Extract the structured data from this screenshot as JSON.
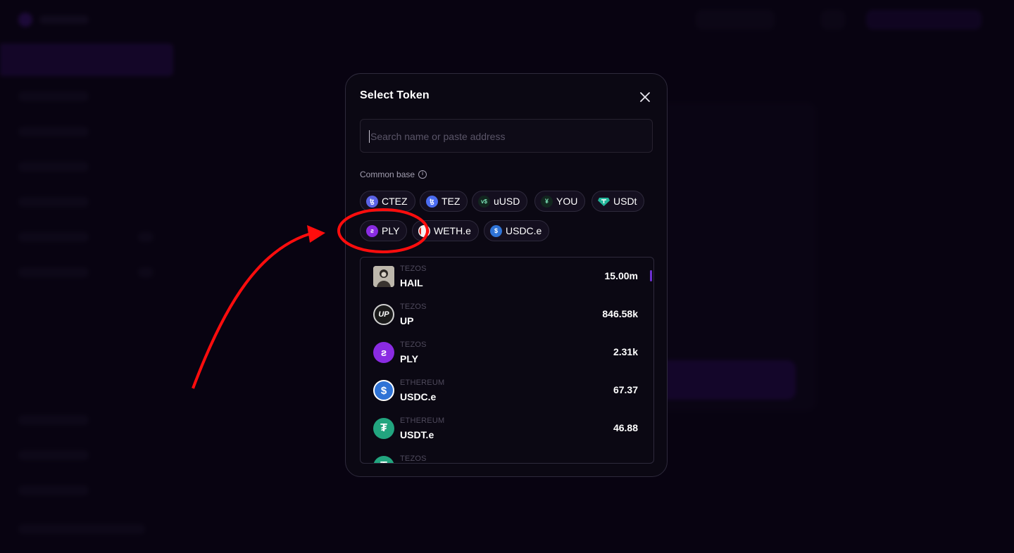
{
  "modal": {
    "title": "Select Token",
    "search_placeholder": "Search name or paste address",
    "common_base_label": "Common base"
  },
  "common_base": [
    {
      "label": "CTEZ",
      "icon": "ctez-icon",
      "color": "#5b63e6"
    },
    {
      "label": "TEZ",
      "icon": "tez-icon",
      "color": "#4b6cf0"
    },
    {
      "label": "uUSD",
      "icon": "uusd-icon",
      "color": "#1f3a2e"
    },
    {
      "label": "YOU",
      "icon": "you-icon",
      "color": "#1c3a30"
    },
    {
      "label": "USDt",
      "icon": "usdt-icon",
      "color": "#22b59a"
    },
    {
      "label": "PLY",
      "icon": "ply-icon",
      "color": "#8a2be2"
    },
    {
      "label": "WETH.e",
      "icon": "weth-icon",
      "color": "#e8e8e8"
    },
    {
      "label": "USDC.e",
      "icon": "usdc-icon",
      "color": "#2f73d6"
    }
  ],
  "tokens": [
    {
      "chain": "TEZOS",
      "symbol": "HAIL",
      "balance": "15.00m",
      "icon": "hail-icon"
    },
    {
      "chain": "TEZOS",
      "symbol": "UP",
      "balance": "846.58k",
      "icon": "up-icon"
    },
    {
      "chain": "TEZOS",
      "symbol": "PLY",
      "balance": "2.31k",
      "icon": "ply-icon"
    },
    {
      "chain": "ETHEREUM",
      "symbol": "USDC.e",
      "balance": "67.37",
      "icon": "usdc-icon"
    },
    {
      "chain": "ETHEREUM",
      "symbol": "USDT.e",
      "balance": "46.88",
      "icon": "usdt-icon"
    },
    {
      "chain": "TEZOS",
      "symbol": "",
      "balance": "",
      "icon": "usdt-icon"
    }
  ],
  "colors": {
    "annotation": "#ff0d0d",
    "accent": "#6d2fd0"
  }
}
